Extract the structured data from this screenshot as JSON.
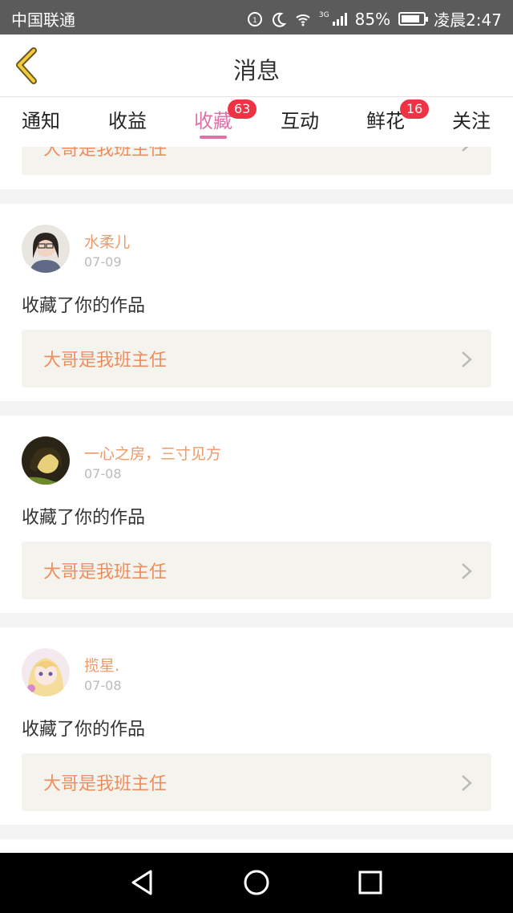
{
  "status_bar": {
    "carrier": "中国联通",
    "network": "3G",
    "battery": "85%",
    "time": "凌晨2:47",
    "battery_level": 0.85
  },
  "header": {
    "title": "消息"
  },
  "tabs": [
    {
      "label": "通知",
      "badge": ""
    },
    {
      "label": "收益",
      "badge": ""
    },
    {
      "label": "收藏",
      "badge": "63"
    },
    {
      "label": "互动",
      "badge": ""
    },
    {
      "label": "鲜花",
      "badge": "16"
    },
    {
      "label": "关注",
      "badge": ""
    }
  ],
  "partial_item": {
    "work_title": "大哥是我班主任"
  },
  "items": [
    {
      "user": "水柔儿",
      "date": "07-09",
      "action": "收藏了你的作品",
      "work_title": "大哥是我班主任"
    },
    {
      "user": "一心之房，三寸见方",
      "date": "07-08",
      "action": "收藏了你的作品",
      "work_title": "大哥是我班主任"
    },
    {
      "user": "揽星.",
      "date": "07-08",
      "action": "收藏了你的作品",
      "work_title": "大哥是我班主任"
    }
  ],
  "colors": {
    "accent": "#e070a8",
    "username": "#ec9a6a",
    "work_title": "#ec8f5e",
    "badge": "#ee3344"
  },
  "icons": [
    "back-arrow-icon",
    "chevron-right-icon",
    "nav-back-icon",
    "nav-home-icon",
    "nav-recent-icon"
  ]
}
